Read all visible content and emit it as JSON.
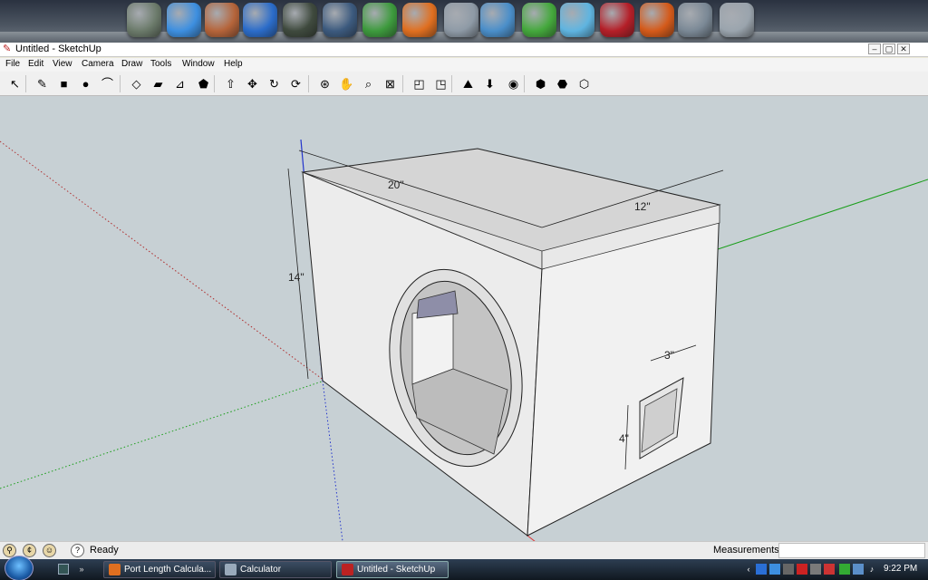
{
  "dock": {
    "icons": [
      {
        "name": "recycle-bin-dock-icon",
        "color": "#6b7a6a"
      },
      {
        "name": "dropbox-icon",
        "color": "#3d8fe0"
      },
      {
        "name": "paint-brush-icon",
        "color": "#b5643a"
      },
      {
        "name": "google-earth-icon",
        "color": "#2b6cc9"
      },
      {
        "name": "spider-icon",
        "color": "#3f4a3e"
      },
      {
        "name": "wizard-icon",
        "color": "#3c5a7e"
      },
      {
        "name": "folder-icon",
        "color": "#3d9a3d"
      },
      {
        "name": "firefox-icon",
        "color": "#e06f20"
      },
      {
        "name": "chrome-icon",
        "color": "#8e9aa6"
      },
      {
        "name": "audio-wave-icon",
        "color": "#4a8ec9"
      },
      {
        "name": "utorrent-icon",
        "color": "#44a83c"
      },
      {
        "name": "winamp-icon",
        "color": "#5fb4e0"
      },
      {
        "name": "autocad-icon",
        "color": "#b41f28"
      },
      {
        "name": "matlab-icon",
        "color": "#d45a1a"
      },
      {
        "name": "itunes-icon",
        "color": "#7a8895"
      },
      {
        "name": "trash-icon",
        "color": "#9aa4ad"
      }
    ]
  },
  "window": {
    "title": "Untitled - SketchUp",
    "menu": [
      "File",
      "Edit",
      "View",
      "Camera",
      "Draw",
      "Tools",
      "Window",
      "Help"
    ]
  },
  "toolbar": {
    "tools": [
      {
        "name": "select-tool-icon",
        "glyph": "↖"
      },
      {
        "name": "pencil-tool-icon",
        "glyph": "✎"
      },
      {
        "name": "rectangle-tool-icon",
        "glyph": "■"
      },
      {
        "name": "circle-tool-icon",
        "glyph": "●"
      },
      {
        "name": "arc-tool-icon",
        "glyph": "⌒"
      },
      {
        "name": "make-component-icon",
        "glyph": "◇"
      },
      {
        "name": "eraser-tool-icon",
        "glyph": "▰"
      },
      {
        "name": "tape-measure-icon",
        "glyph": "⊿"
      },
      {
        "name": "paint-bucket-icon",
        "glyph": "⬟"
      },
      {
        "name": "push-pull-icon",
        "glyph": "⇧"
      },
      {
        "name": "move-tool-icon",
        "glyph": "✥"
      },
      {
        "name": "rotate-tool-icon",
        "glyph": "↻"
      },
      {
        "name": "offset-tool-icon",
        "glyph": "⟳"
      },
      {
        "name": "orbit-tool-icon",
        "glyph": "⊛"
      },
      {
        "name": "pan-tool-icon",
        "glyph": "✋"
      },
      {
        "name": "zoom-tool-icon",
        "glyph": "⌕"
      },
      {
        "name": "zoom-extents-icon",
        "glyph": "⊠"
      },
      {
        "name": "previous-view-icon",
        "glyph": "◰"
      },
      {
        "name": "next-view-icon",
        "glyph": "◳"
      },
      {
        "name": "google-earth-view-icon",
        "glyph": "⛰"
      },
      {
        "name": "place-model-icon",
        "glyph": "⬇"
      },
      {
        "name": "get-models-icon",
        "glyph": "◉"
      },
      {
        "name": "share-model-icon",
        "glyph": "⬢"
      },
      {
        "name": "share-component-icon",
        "glyph": "⬣"
      },
      {
        "name": "components-icon",
        "glyph": "⬡"
      }
    ]
  },
  "model": {
    "dimensions": {
      "width": "20\"",
      "depth": "12\"",
      "height": "14\"",
      "port_width": "3\"",
      "port_height": "4\""
    },
    "colors": {
      "sky": "#c7d0d4",
      "box_top": "#d5d5d5",
      "box_face": "#ececec",
      "axis_red": "#d33",
      "axis_green": "#1a9e1a",
      "axis_blue": "#2233cc"
    }
  },
  "status": {
    "text": "Ready",
    "measurements_label": "Measurements",
    "measurements_value": ""
  },
  "taskbar": {
    "buttons": [
      {
        "label": "Port Length Calcula..."
      },
      {
        "label": "Calculator"
      },
      {
        "label": "Untitled - SketchUp"
      }
    ],
    "clock": "9:22 PM"
  }
}
